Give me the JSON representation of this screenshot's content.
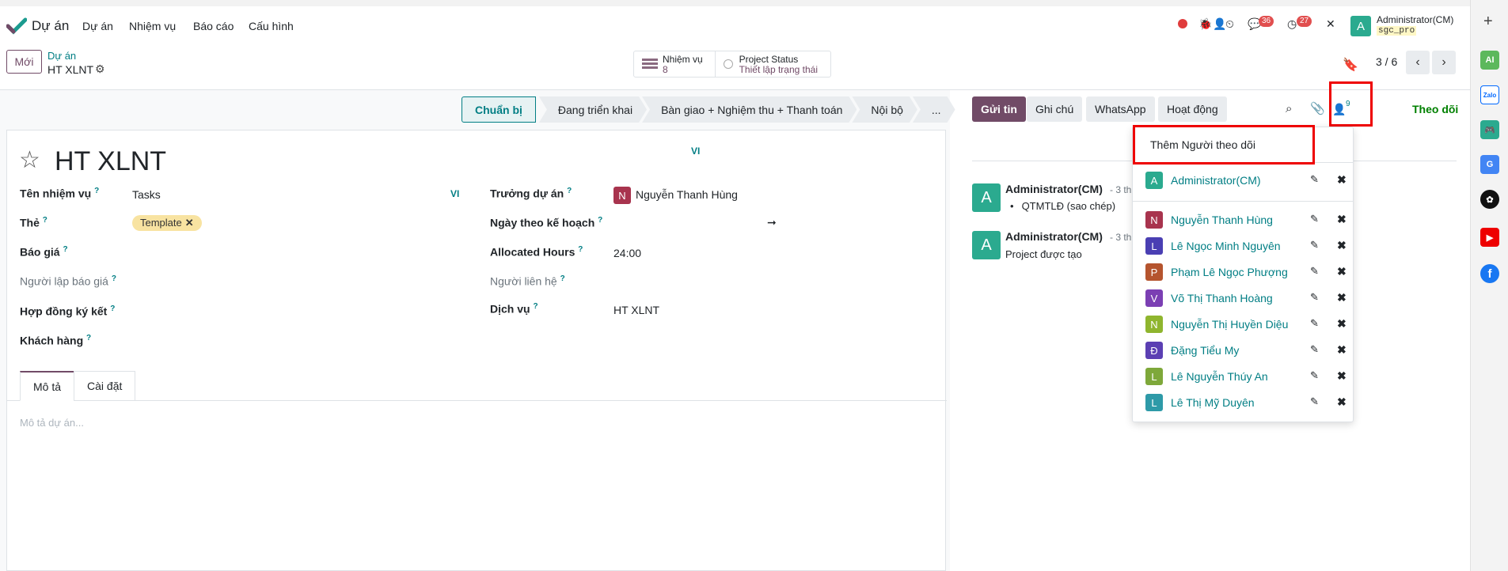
{
  "navbar": {
    "app_name": "Dự án",
    "menu": [
      "Dự án",
      "Nhiệm vụ",
      "Báo cáo",
      "Cấu hình"
    ],
    "messages_count": "36",
    "activities_count": "27",
    "user_initial": "A",
    "user_name": "Administrator(CM)",
    "database": "sgc_pro"
  },
  "control_panel": {
    "new_button": "Mới",
    "breadcrumb_parent": "Dự án",
    "breadcrumb_current": "HT XLNT",
    "stat_tasks_label": "Nhiệm vụ",
    "stat_tasks_value": "8",
    "stat_status_label": "Project Status",
    "stat_status_value": "Thiết lập trạng thái",
    "pager": "3 / 6"
  },
  "statusbar": {
    "stages": [
      "Chuẩn bị",
      "Đang triển khai",
      "Bàn giao + Nghiệm thu + Thanh toán",
      "Nội bộ",
      "..."
    ],
    "active_index": 0
  },
  "form": {
    "title": "HT XLNT",
    "lang": "VI",
    "left_fields": [
      {
        "label": "Tên nhiệm vụ",
        "value": "Tasks"
      },
      {
        "label": "Thẻ",
        "value": "Template"
      },
      {
        "label": "Báo giá",
        "value": ""
      },
      {
        "label": "Người lập báo giá",
        "value": ""
      },
      {
        "label": "Hợp đồng ký kết",
        "value": ""
      },
      {
        "label": "Khách hàng",
        "value": ""
      }
    ],
    "right_fields": [
      {
        "label": "Trưởng dự án",
        "value": "Nguyễn Thanh Hùng",
        "initial": "N"
      },
      {
        "label": "Ngày theo kế hoạch",
        "value": "➞"
      },
      {
        "label": "Allocated Hours",
        "value": "24:00"
      },
      {
        "label": "Người liên hệ",
        "value": ""
      },
      {
        "label": "Dịch vụ",
        "value": "HT XLNT"
      }
    ],
    "help_mark": "?",
    "tabs": [
      "Mô tả",
      "Cài đặt"
    ],
    "description_placeholder": "Mô tả dự án..."
  },
  "chatter": {
    "buttons": [
      "Gửi tin",
      "Ghi chú",
      "WhatsApp",
      "Hoạt động"
    ],
    "followers_count": "9",
    "follow_label": "Theo dõi",
    "messages": [
      {
        "initial": "A",
        "author": "Administrator(CM)",
        "date": "- 3 th",
        "body": "QTMTLĐ (sao chép)",
        "bullet": true
      },
      {
        "initial": "A",
        "author": "Administrator(CM)",
        "date": "- 3 th",
        "body": "Project được tạo",
        "bullet": false
      }
    ]
  },
  "followers_dropdown": {
    "add_label": "Thêm Người theo dõi",
    "followers": [
      {
        "initial": "A",
        "name": "Administrator(CM)",
        "color": "#2baa8f"
      },
      {
        "initial": "N",
        "name": "Nguyễn Thanh Hùng",
        "color": "#a8344e"
      },
      {
        "initial": "L",
        "name": "Lê Ngọc Minh Nguyên",
        "color": "#4a3fb3"
      },
      {
        "initial": "P",
        "name": "Phạm Lê Ngọc Phượng",
        "color": "#b5542e"
      },
      {
        "initial": "V",
        "name": "Võ Thị Thanh Hoàng",
        "color": "#7b3fb3"
      },
      {
        "initial": "N",
        "name": "Nguyễn Thị Huyền Diệu",
        "color": "#8fb52e"
      },
      {
        "initial": "Đ",
        "name": "Đặng Tiểu My",
        "color": "#5b3fb3"
      },
      {
        "initial": "L",
        "name": "Lê Nguyễn Thúy An",
        "color": "#7ea83a"
      },
      {
        "initial": "L",
        "name": "Lê Thị Mỹ Duyên",
        "color": "#2e9aa8"
      }
    ],
    "edit_glyph": "✎",
    "remove_glyph": "✖"
  },
  "dock": [
    "AI",
    "Zalo"
  ],
  "colors": {
    "brand": "#714b67",
    "accent": "#017e84",
    "follow": "#008000",
    "highlight": "#e00000"
  }
}
